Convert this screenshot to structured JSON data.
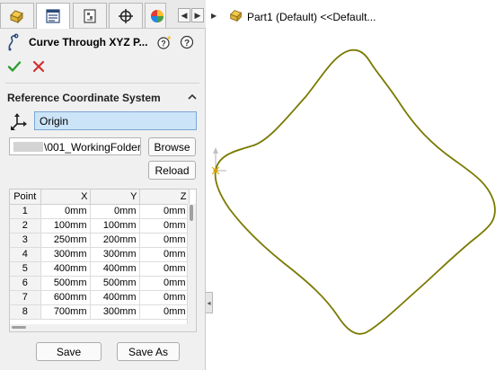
{
  "tabs": [
    {
      "name": "feature-manager",
      "icon": "part-icon"
    },
    {
      "name": "property-manager",
      "icon": "property-manager-icon"
    },
    {
      "name": "configuration-manager",
      "icon": "configuration-icon"
    },
    {
      "name": "dimxpert-manager",
      "icon": "crosshair-icon"
    },
    {
      "name": "display-manager",
      "icon": "appearance-icon"
    }
  ],
  "feature": {
    "title": "Curve Through XYZ P...",
    "icon": "curve-icon"
  },
  "reference": {
    "section_title": "Reference Coordinate System",
    "coordinate_system": "Origin"
  },
  "file": {
    "path": "\\001_WorkingFolder\\",
    "browse_label": "Browse",
    "reload_label": "Reload"
  },
  "table": {
    "headers": [
      "Point",
      "X",
      "Y",
      "Z"
    ],
    "rows": [
      [
        "1",
        "0mm",
        "0mm",
        "0mm"
      ],
      [
        "2",
        "100mm",
        "100mm",
        "0mm"
      ],
      [
        "3",
        "250mm",
        "200mm",
        "0mm"
      ],
      [
        "4",
        "300mm",
        "300mm",
        "0mm"
      ],
      [
        "5",
        "400mm",
        "400mm",
        "0mm"
      ],
      [
        "6",
        "500mm",
        "500mm",
        "0mm"
      ],
      [
        "7",
        "600mm",
        "400mm",
        "0mm"
      ],
      [
        "8",
        "700mm",
        "300mm",
        "0mm"
      ]
    ]
  },
  "actions": {
    "save_label": "Save",
    "save_as_label": "Save As"
  },
  "tree": {
    "label": "Part1 (Default) <<Default..."
  },
  "colors": {
    "curve": "#7a7a00",
    "ok": "#2f9e2f",
    "cancel": "#d32f2f",
    "selection": "#cce4f7"
  }
}
